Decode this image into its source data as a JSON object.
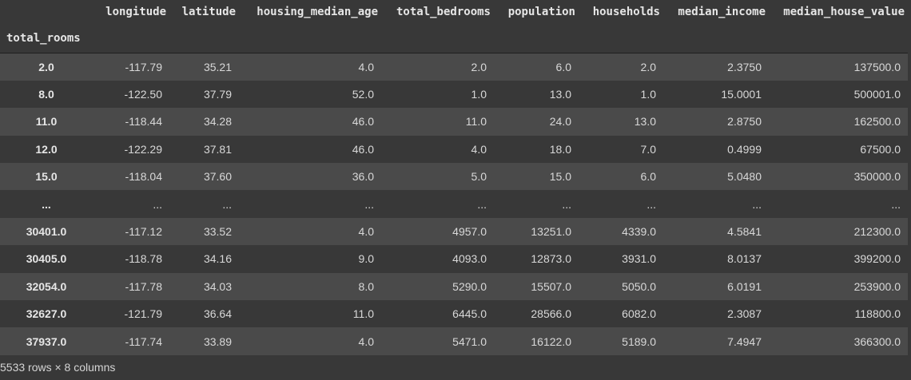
{
  "dataframe": {
    "index_name": "total_rooms",
    "columns": [
      "longitude",
      "latitude",
      "housing_median_age",
      "total_bedrooms",
      "population",
      "households",
      "median_income",
      "median_house_value"
    ],
    "rows": [
      {
        "index": "2.0",
        "cells": [
          "-117.79",
          "35.21",
          "4.0",
          "2.0",
          "6.0",
          "2.0",
          "2.3750",
          "137500.0"
        ]
      },
      {
        "index": "8.0",
        "cells": [
          "-122.50",
          "37.79",
          "52.0",
          "1.0",
          "13.0",
          "1.0",
          "15.0001",
          "500001.0"
        ]
      },
      {
        "index": "11.0",
        "cells": [
          "-118.44",
          "34.28",
          "46.0",
          "11.0",
          "24.0",
          "13.0",
          "2.8750",
          "162500.0"
        ]
      },
      {
        "index": "12.0",
        "cells": [
          "-122.29",
          "37.81",
          "46.0",
          "4.0",
          "18.0",
          "7.0",
          "0.4999",
          "67500.0"
        ]
      },
      {
        "index": "15.0",
        "cells": [
          "-118.04",
          "37.60",
          "36.0",
          "5.0",
          "15.0",
          "6.0",
          "5.0480",
          "350000.0"
        ]
      },
      {
        "index": "...",
        "cells": [
          "...",
          "...",
          "...",
          "...",
          "...",
          "...",
          "...",
          "..."
        ]
      },
      {
        "index": "30401.0",
        "cells": [
          "-117.12",
          "33.52",
          "4.0",
          "4957.0",
          "13251.0",
          "4339.0",
          "4.5841",
          "212300.0"
        ]
      },
      {
        "index": "30405.0",
        "cells": [
          "-118.78",
          "34.16",
          "9.0",
          "4093.0",
          "12873.0",
          "3931.0",
          "8.0137",
          "399200.0"
        ]
      },
      {
        "index": "32054.0",
        "cells": [
          "-117.78",
          "34.03",
          "8.0",
          "5290.0",
          "15507.0",
          "5050.0",
          "6.0191",
          "253900.0"
        ]
      },
      {
        "index": "32627.0",
        "cells": [
          "-121.79",
          "36.64",
          "11.0",
          "6445.0",
          "28566.0",
          "6082.0",
          "2.3087",
          "118800.0"
        ]
      },
      {
        "index": "37937.0",
        "cells": [
          "-117.74",
          "33.89",
          "4.0",
          "5471.0",
          "16122.0",
          "5189.0",
          "7.4947",
          "366300.0"
        ]
      }
    ],
    "footer": "5533 rows × 8 columns"
  }
}
